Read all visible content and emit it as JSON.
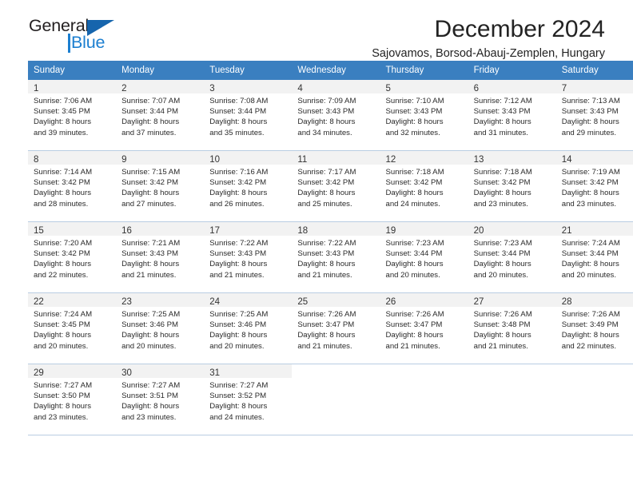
{
  "brand": {
    "name_top": "General",
    "name_bottom": "Blue",
    "accent_color": "#1c7fd0",
    "triangle_color": "#1665ad"
  },
  "header": {
    "month_title": "December 2024",
    "location": "Sajovamos, Borsod-Abauj-Zemplen, Hungary"
  },
  "calendar": {
    "header_bg": "#3a7fc0",
    "weekday_headers": [
      "Sunday",
      "Monday",
      "Tuesday",
      "Wednesday",
      "Thursday",
      "Friday",
      "Saturday"
    ],
    "weeks": [
      [
        {
          "day": "1",
          "sunrise": "Sunrise: 7:06 AM",
          "sunset": "Sunset: 3:45 PM",
          "daylight_1": "Daylight: 8 hours",
          "daylight_2": "and 39 minutes."
        },
        {
          "day": "2",
          "sunrise": "Sunrise: 7:07 AM",
          "sunset": "Sunset: 3:44 PM",
          "daylight_1": "Daylight: 8 hours",
          "daylight_2": "and 37 minutes."
        },
        {
          "day": "3",
          "sunrise": "Sunrise: 7:08 AM",
          "sunset": "Sunset: 3:44 PM",
          "daylight_1": "Daylight: 8 hours",
          "daylight_2": "and 35 minutes."
        },
        {
          "day": "4",
          "sunrise": "Sunrise: 7:09 AM",
          "sunset": "Sunset: 3:43 PM",
          "daylight_1": "Daylight: 8 hours",
          "daylight_2": "and 34 minutes."
        },
        {
          "day": "5",
          "sunrise": "Sunrise: 7:10 AM",
          "sunset": "Sunset: 3:43 PM",
          "daylight_1": "Daylight: 8 hours",
          "daylight_2": "and 32 minutes."
        },
        {
          "day": "6",
          "sunrise": "Sunrise: 7:12 AM",
          "sunset": "Sunset: 3:43 PM",
          "daylight_1": "Daylight: 8 hours",
          "daylight_2": "and 31 minutes."
        },
        {
          "day": "7",
          "sunrise": "Sunrise: 7:13 AM",
          "sunset": "Sunset: 3:43 PM",
          "daylight_1": "Daylight: 8 hours",
          "daylight_2": "and 29 minutes."
        }
      ],
      [
        {
          "day": "8",
          "sunrise": "Sunrise: 7:14 AM",
          "sunset": "Sunset: 3:42 PM",
          "daylight_1": "Daylight: 8 hours",
          "daylight_2": "and 28 minutes."
        },
        {
          "day": "9",
          "sunrise": "Sunrise: 7:15 AM",
          "sunset": "Sunset: 3:42 PM",
          "daylight_1": "Daylight: 8 hours",
          "daylight_2": "and 27 minutes."
        },
        {
          "day": "10",
          "sunrise": "Sunrise: 7:16 AM",
          "sunset": "Sunset: 3:42 PM",
          "daylight_1": "Daylight: 8 hours",
          "daylight_2": "and 26 minutes."
        },
        {
          "day": "11",
          "sunrise": "Sunrise: 7:17 AM",
          "sunset": "Sunset: 3:42 PM",
          "daylight_1": "Daylight: 8 hours",
          "daylight_2": "and 25 minutes."
        },
        {
          "day": "12",
          "sunrise": "Sunrise: 7:18 AM",
          "sunset": "Sunset: 3:42 PM",
          "daylight_1": "Daylight: 8 hours",
          "daylight_2": "and 24 minutes."
        },
        {
          "day": "13",
          "sunrise": "Sunrise: 7:18 AM",
          "sunset": "Sunset: 3:42 PM",
          "daylight_1": "Daylight: 8 hours",
          "daylight_2": "and 23 minutes."
        },
        {
          "day": "14",
          "sunrise": "Sunrise: 7:19 AM",
          "sunset": "Sunset: 3:42 PM",
          "daylight_1": "Daylight: 8 hours",
          "daylight_2": "and 23 minutes."
        }
      ],
      [
        {
          "day": "15",
          "sunrise": "Sunrise: 7:20 AM",
          "sunset": "Sunset: 3:42 PM",
          "daylight_1": "Daylight: 8 hours",
          "daylight_2": "and 22 minutes."
        },
        {
          "day": "16",
          "sunrise": "Sunrise: 7:21 AM",
          "sunset": "Sunset: 3:43 PM",
          "daylight_1": "Daylight: 8 hours",
          "daylight_2": "and 21 minutes."
        },
        {
          "day": "17",
          "sunrise": "Sunrise: 7:22 AM",
          "sunset": "Sunset: 3:43 PM",
          "daylight_1": "Daylight: 8 hours",
          "daylight_2": "and 21 minutes."
        },
        {
          "day": "18",
          "sunrise": "Sunrise: 7:22 AM",
          "sunset": "Sunset: 3:43 PM",
          "daylight_1": "Daylight: 8 hours",
          "daylight_2": "and 21 minutes."
        },
        {
          "day": "19",
          "sunrise": "Sunrise: 7:23 AM",
          "sunset": "Sunset: 3:44 PM",
          "daylight_1": "Daylight: 8 hours",
          "daylight_2": "and 20 minutes."
        },
        {
          "day": "20",
          "sunrise": "Sunrise: 7:23 AM",
          "sunset": "Sunset: 3:44 PM",
          "daylight_1": "Daylight: 8 hours",
          "daylight_2": "and 20 minutes."
        },
        {
          "day": "21",
          "sunrise": "Sunrise: 7:24 AM",
          "sunset": "Sunset: 3:44 PM",
          "daylight_1": "Daylight: 8 hours",
          "daylight_2": "and 20 minutes."
        }
      ],
      [
        {
          "day": "22",
          "sunrise": "Sunrise: 7:24 AM",
          "sunset": "Sunset: 3:45 PM",
          "daylight_1": "Daylight: 8 hours",
          "daylight_2": "and 20 minutes."
        },
        {
          "day": "23",
          "sunrise": "Sunrise: 7:25 AM",
          "sunset": "Sunset: 3:46 PM",
          "daylight_1": "Daylight: 8 hours",
          "daylight_2": "and 20 minutes."
        },
        {
          "day": "24",
          "sunrise": "Sunrise: 7:25 AM",
          "sunset": "Sunset: 3:46 PM",
          "daylight_1": "Daylight: 8 hours",
          "daylight_2": "and 20 minutes."
        },
        {
          "day": "25",
          "sunrise": "Sunrise: 7:26 AM",
          "sunset": "Sunset: 3:47 PM",
          "daylight_1": "Daylight: 8 hours",
          "daylight_2": "and 21 minutes."
        },
        {
          "day": "26",
          "sunrise": "Sunrise: 7:26 AM",
          "sunset": "Sunset: 3:47 PM",
          "daylight_1": "Daylight: 8 hours",
          "daylight_2": "and 21 minutes."
        },
        {
          "day": "27",
          "sunrise": "Sunrise: 7:26 AM",
          "sunset": "Sunset: 3:48 PM",
          "daylight_1": "Daylight: 8 hours",
          "daylight_2": "and 21 minutes."
        },
        {
          "day": "28",
          "sunrise": "Sunrise: 7:26 AM",
          "sunset": "Sunset: 3:49 PM",
          "daylight_1": "Daylight: 8 hours",
          "daylight_2": "and 22 minutes."
        }
      ],
      [
        {
          "day": "29",
          "sunrise": "Sunrise: 7:27 AM",
          "sunset": "Sunset: 3:50 PM",
          "daylight_1": "Daylight: 8 hours",
          "daylight_2": "and 23 minutes."
        },
        {
          "day": "30",
          "sunrise": "Sunrise: 7:27 AM",
          "sunset": "Sunset: 3:51 PM",
          "daylight_1": "Daylight: 8 hours",
          "daylight_2": "and 23 minutes."
        },
        {
          "day": "31",
          "sunrise": "Sunrise: 7:27 AM",
          "sunset": "Sunset: 3:52 PM",
          "daylight_1": "Daylight: 8 hours",
          "daylight_2": "and 24 minutes."
        },
        {
          "day": "",
          "sunrise": "",
          "sunset": "",
          "daylight_1": "",
          "daylight_2": ""
        },
        {
          "day": "",
          "sunrise": "",
          "sunset": "",
          "daylight_1": "",
          "daylight_2": ""
        },
        {
          "day": "",
          "sunrise": "",
          "sunset": "",
          "daylight_1": "",
          "daylight_2": ""
        },
        {
          "day": "",
          "sunrise": "",
          "sunset": "",
          "daylight_1": "",
          "daylight_2": ""
        }
      ]
    ]
  }
}
